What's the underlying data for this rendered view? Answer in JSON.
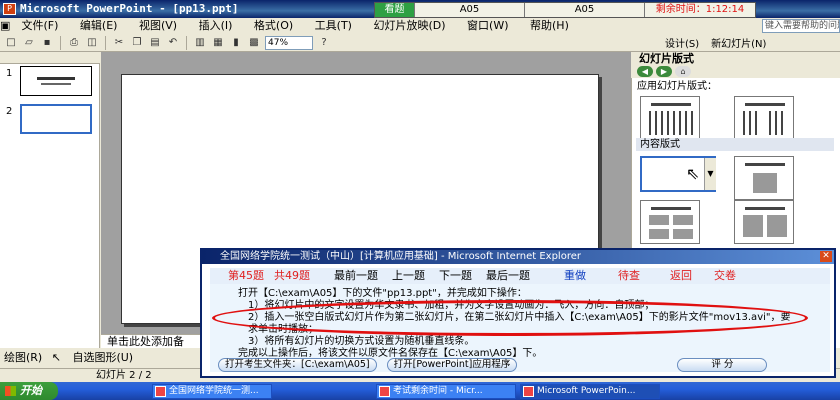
{
  "window": {
    "title": "Microsoft PowerPoint - [pp13.ppt]"
  },
  "exam_bar": {
    "tab": "看题",
    "code1": "A05",
    "code2": "A05",
    "timer": "剩余时间：1:12:14"
  },
  "menu": [
    "文件(F)",
    "编辑(E)",
    "视图(V)",
    "插入(I)",
    "格式(O)",
    "工具(T)",
    "幻灯片放映(D)",
    "窗口(W)",
    "帮助(H)"
  ],
  "help_placeholder": "键入需要帮助的问题",
  "toolbar": {
    "zoom": "47%",
    "design_label": "设计(S)",
    "new_slide_label": "新幻灯片(N)"
  },
  "thumbs": [
    {
      "num": "1"
    },
    {
      "num": "2"
    }
  ],
  "notes_placeholder": "单击此处添加备",
  "task_pane": {
    "title": "幻灯片版式",
    "apply_label": "应用幻灯片版式：",
    "content_section": "内容版式"
  },
  "draw_bar": {
    "draw_label": "绘图(R)",
    "autoshape_label": "自选图形(U)"
  },
  "status": {
    "slide_count": "幻灯片 2 / 2"
  },
  "taskbar": {
    "start": "开始",
    "tasks": [
      "全国网络学院统一测...",
      "考试剩余时间 - Micr...",
      "Microsoft PowerPoin..."
    ]
  },
  "dialog": {
    "title": "全国网络学院统一测试（中山）[计算机应用基础] - Microsoft Internet Explorer",
    "question_no": "第45题",
    "total": "共49题",
    "nav": [
      "最前一题",
      "上一题",
      "下一题",
      "最后一题",
      "重做",
      "待查",
      "返回",
      "交卷"
    ],
    "lines": [
      "打开【C:\\exam\\A05】下的文件\"pp13.ppt\"，并完成如下操作：",
      "1）将幻灯片中的文字设置为华文隶书、加粗，并为文字设置动画为：飞入，方向：自顶部；",
      "2）插入一张空白版式幻灯片作为第二张幻灯片，在第二张幻灯片中插入【C:\\exam\\A05】下的影片文件\"mov13.avi\"，要求单击时播放；",
      "3）将所有幻灯片的切换方式设置为随机垂直线条。",
      "完成以上操作后，将该文件以原文件名保存在【C:\\exam\\A05】下。"
    ],
    "btn_open_folder": "打开考生文件夹：[C:\\exam\\A05]",
    "btn_open_app": "打开[PowerPoint]应用程序",
    "btn_score": "评 分"
  },
  "colors": {
    "title_bar": "#0a246a",
    "exam_green": "#2ea043",
    "alert_red": "#e01010",
    "nav_red": "#e02020"
  }
}
